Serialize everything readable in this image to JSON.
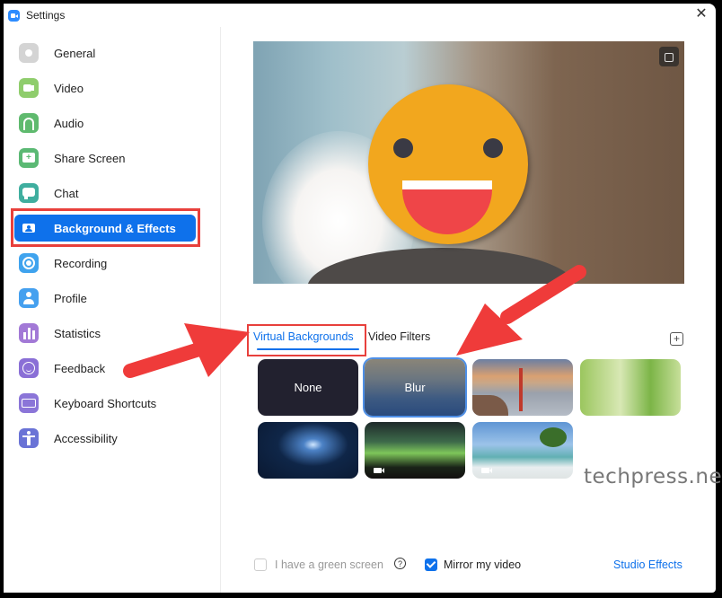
{
  "window": {
    "title": "Settings",
    "close_label": "✕"
  },
  "sidebar": {
    "items": [
      {
        "label": "General",
        "icon": "gear-icon",
        "color": "#c8c8c8"
      },
      {
        "label": "Video",
        "icon": "video-camera-icon",
        "color": "#8fcd6c"
      },
      {
        "label": "Audio",
        "icon": "headphones-icon",
        "color": "#5fba6e"
      },
      {
        "label": "Share Screen",
        "icon": "share-screen-icon",
        "color": "#5bb974"
      },
      {
        "label": "Chat",
        "icon": "chat-bubble-icon",
        "color": "#3fae9f"
      },
      {
        "label": "Background & Effects",
        "icon": "background-person-icon",
        "color": "#ffffff",
        "active": true
      },
      {
        "label": "Recording",
        "icon": "record-icon",
        "color": "#3fa3ee"
      },
      {
        "label": "Profile",
        "icon": "profile-icon",
        "color": "#45a0ef"
      },
      {
        "label": "Statistics",
        "icon": "bar-chart-icon",
        "color": "#a279d6"
      },
      {
        "label": "Feedback",
        "icon": "smiley-icon",
        "color": "#8a6fd6"
      },
      {
        "label": "Keyboard Shortcuts",
        "icon": "keyboard-icon",
        "color": "#8b75d8"
      },
      {
        "label": "Accessibility",
        "icon": "accessibility-icon",
        "color": "#6a73d6"
      }
    ]
  },
  "main": {
    "preview": {
      "rotate_icon": "rotate-camera-icon"
    },
    "tabs": [
      {
        "label": "Virtual Backgrounds",
        "active": true
      },
      {
        "label": "Video Filters",
        "active": false
      }
    ],
    "add_label": "+",
    "backgrounds": [
      {
        "label": "None",
        "kind": "none"
      },
      {
        "label": "Blur",
        "kind": "blur",
        "selected": true
      },
      {
        "label": "",
        "kind": "golden-gate-bridge"
      },
      {
        "label": "",
        "kind": "grass"
      },
      {
        "label": "",
        "kind": "earth-from-space"
      },
      {
        "label": "",
        "kind": "aurora",
        "video": true
      },
      {
        "label": "",
        "kind": "beach-palm",
        "video": true
      }
    ],
    "footer": {
      "green_screen_label": "I have a green screen",
      "green_screen_checked": false,
      "help_label": "?",
      "mirror_label": "Mirror my video",
      "mirror_checked": true,
      "studio_effects_label": "Studio Effects"
    }
  },
  "watermark": "techpress.net",
  "colors": {
    "accent": "#0e71eb",
    "annotation": "#e8403c"
  }
}
